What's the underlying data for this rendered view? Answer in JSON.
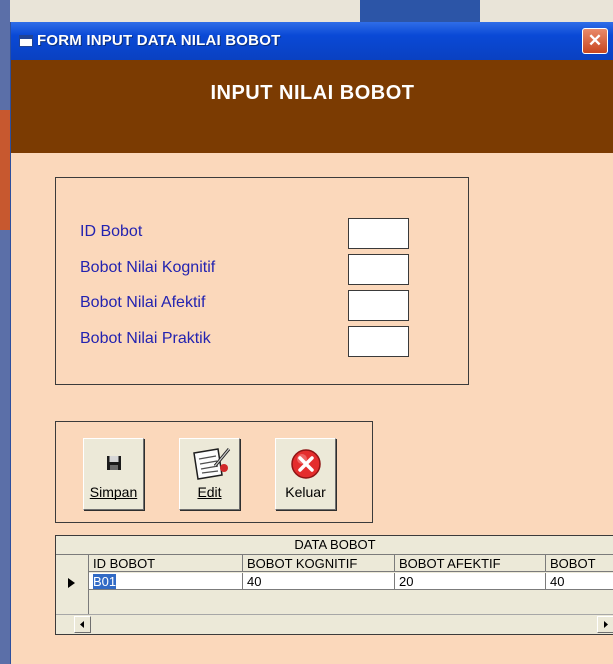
{
  "window": {
    "title": "FORM INPUT DATA NILAI BOBOT",
    "close_glyph": "✕"
  },
  "header": {
    "title": "INPUT NILAI BOBOT"
  },
  "form": {
    "fields": [
      {
        "label": "ID Bobot",
        "value": ""
      },
      {
        "label": "Bobot Nilai Kognitif",
        "value": ""
      },
      {
        "label": "Bobot Nilai Afektif",
        "value": ""
      },
      {
        "label": "Bobot Nilai Praktik",
        "value": ""
      }
    ]
  },
  "buttons": {
    "simpan": {
      "label": "Simpan",
      "icon": "floppy-disk-icon"
    },
    "edit": {
      "label": "Edit",
      "icon": "edit-document-icon"
    },
    "keluar": {
      "label": "Keluar",
      "icon": "exit-x-icon"
    }
  },
  "grid": {
    "caption": "DATA BOBOT",
    "columns": [
      "ID BOBOT",
      "BOBOT KOGNITIF",
      "BOBOT AFEKTIF",
      "BOBOT"
    ],
    "rows": [
      [
        "B01",
        "40",
        "20",
        "40"
      ]
    ]
  },
  "colors": {
    "header_bg": "#7b3b02",
    "form_bg": "#fbd8bb",
    "label_text": "#2323b0",
    "titlebar": "#0a49d6"
  }
}
